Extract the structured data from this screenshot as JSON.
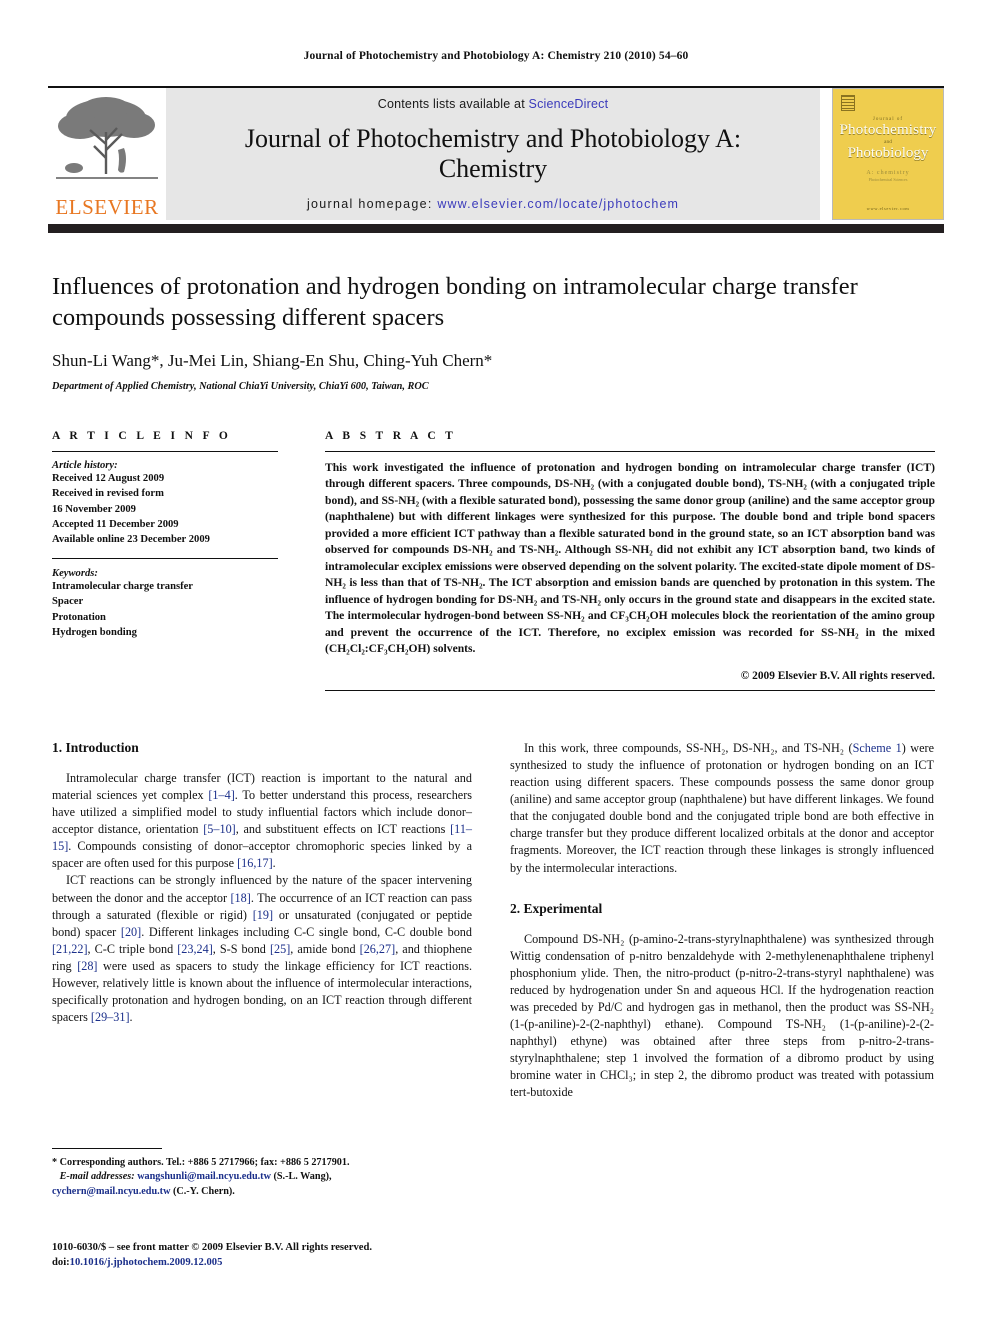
{
  "running_head": "Journal of Photochemistry and Photobiology A: Chemistry 210 (2010) 54–60",
  "masthead": {
    "contents_prefix": "Contents lists available at ",
    "sciencedirect": "ScienceDirect",
    "journal_title": "Journal of Photochemistry and Photobiology A: Chemistry",
    "homepage_prefix": "journal homepage: ",
    "homepage_url": "www.elsevier.com/locate/jphotochem",
    "publisher_logo_text": "ELSEVIER",
    "cover": {
      "journal_of": "Journal of",
      "line1": "Photochemistry",
      "and": "and",
      "line2": "Photobiology",
      "sub": "A: chemistry",
      "sub2": "Photochemical Sciences",
      "bottom": "www.elsevier.com"
    },
    "accent_orange": "#E87722",
    "link_blue": "#3b3bbb",
    "band_gray": "#e6e6e6",
    "cover_yellow": "#efcd4e"
  },
  "article": {
    "title": "Influences of protonation and hydrogen bonding on intramolecular charge transfer compounds possessing different spacers",
    "authors": "Shun-Li Wang*, Ju-Mei Lin, Shiang-En Shu, Ching-Yuh Chern*",
    "affiliation": "Department of Applied Chemistry, National ChiaYi University, ChiaYi 600, Taiwan, ROC"
  },
  "article_info": {
    "heading": "A R T I C L E   I N F O",
    "history_label": "Article history:",
    "history": [
      "Received 12 August 2009",
      "Received in revised form",
      "16 November 2009",
      "Accepted 11 December 2009",
      "Available online 23 December 2009"
    ],
    "keywords_label": "Keywords:",
    "keywords": [
      "Intramolecular charge transfer",
      "Spacer",
      "Protonation",
      "Hydrogen bonding"
    ]
  },
  "abstract": {
    "heading": "A B S T R A C T",
    "body": "This work investigated the influence of protonation and hydrogen bonding on intramolecular charge transfer (ICT) through different spacers. Three compounds, DS-NH₂ (with a conjugated double bond), TS-NH₂ (with a conjugated triple bond), and SS-NH₂ (with a flexible saturated bond), possessing the same donor group (aniline) and the same acceptor group (naphthalene) but with different linkages were synthesized for this purpose. The double bond and triple bond spacers provided a more efficient ICT pathway than a flexible saturated bond in the ground state, so an ICT absorption band was observed for compounds DS-NH₂ and TS-NH₂. Although SS-NH₂ did not exhibit any ICT absorption band, two kinds of intramolecular exciplex emissions were observed depending on the solvent polarity. The excited-state dipole moment of DS-NH₂ is less than that of TS-NH₂. The ICT absorption and emission bands are quenched by protonation in this system. The influence of hydrogen bonding for DS-NH₂ and TS-NH₂ only occurs in the ground state and disappears in the excited state. The intermolecular hydrogen-bond between SS-NH₂ and CF₃CH₂OH molecules block the reorientation of the amino group and prevent the occurrence of the ICT. Therefore, no exciplex emission was recorded for SS-NH₂ in the mixed (CH₂Cl₂:CF₃CH₂OH) solvents.",
    "copyright": "© 2009 Elsevier B.V. All rights reserved."
  },
  "sections": {
    "intro_heading": "1.  Introduction",
    "intro_p1": "Intramolecular charge transfer (ICT) reaction is important to the natural and material sciences yet complex [1–4]. To better understand this process, researchers have utilized a simplified model to study influential factors which include donor–acceptor distance, orientation [5–10], and substituent effects on ICT reactions [11–15]. Compounds consisting of donor–acceptor chromophoric species linked by a spacer are often used for this purpose [16,17].",
    "intro_p2": "ICT reactions can be strongly influenced by the nature of the spacer intervening between the donor and the acceptor [18]. The occurrence of an ICT reaction can pass through a saturated (flexible or rigid) [19] or unsaturated (conjugated or peptide bond) spacer [20]. Different linkages including C-C single bond, C-C double bond [21,22], C-C triple bond [23,24], S-S bond [25], amide bond [26,27], and thiophene ring [28] were used as spacers to study the linkage efficiency for ICT reactions. However, relatively little is known about the influence of intermolecular interactions, specifically protonation and hydrogen bonding, on an ICT reaction through different spacers [29–31].",
    "right_p1": "In this work, three compounds, SS-NH₂, DS-NH₂, and TS-NH₂ (Scheme 1) were synthesized to study the influence of protonation or hydrogen bonding on an ICT reaction using different spacers. These compounds possess the same donor group (aniline) and same acceptor group (naphthalene) but have different linkages. We found that the conjugated double bond and the conjugated triple bond are both effective in charge transfer but they produce different localized orbitals at the donor and acceptor fragments. Moreover, the ICT reaction through these linkages is strongly influenced by the intermolecular interactions.",
    "exp_heading": "2.  Experimental",
    "exp_p1": "Compound DS-NH₂ (p-amino-2-trans-styrylnaphthalene) was synthesized through Wittig condensation of p-nitro benzaldehyde with 2-methylenenaphthalene triphenyl phosphonium ylide. Then, the nitro-product (p-nitro-2-trans-styryl naphthalene) was reduced by hydrogenation under Sn and aqueous HCl. If the hydrogenation reaction was preceded by Pd/C and hydrogen gas in methanol, then the product was SS-NH₂ (1-(p-aniline)-2-(2-naphthyl) ethane). Compound TS-NH₂ (1-(p-aniline)-2-(2-naphthyl) ethyne) was obtained after three steps from p-nitro-2-trans-styrylnaphthalene; step 1 involved the formation of a dibromo product by using bromine water in CHCl₃; in step 2, the dibromo product was treated with potassium tert-butoxide",
    "scheme_link": "Scheme 1"
  },
  "footnotes": {
    "corresponding": "* Corresponding authors. Tel.: +886 5 2717966; fax: +886 5 2717901.",
    "email_label": "E-mail addresses:",
    "email1": "wangshunli@mail.ncyu.edu.tw",
    "email1_owner": "(S.-L. Wang),",
    "email2": "cychern@mail.ncyu.edu.tw",
    "email2_owner": "(C.-Y. Chern).",
    "issn_line": "1010-6030/$ – see front matter © 2009 Elsevier B.V. All rights reserved.",
    "doi_label": "doi:",
    "doi": "10.1016/j.jphotochem.2009.12.005"
  }
}
